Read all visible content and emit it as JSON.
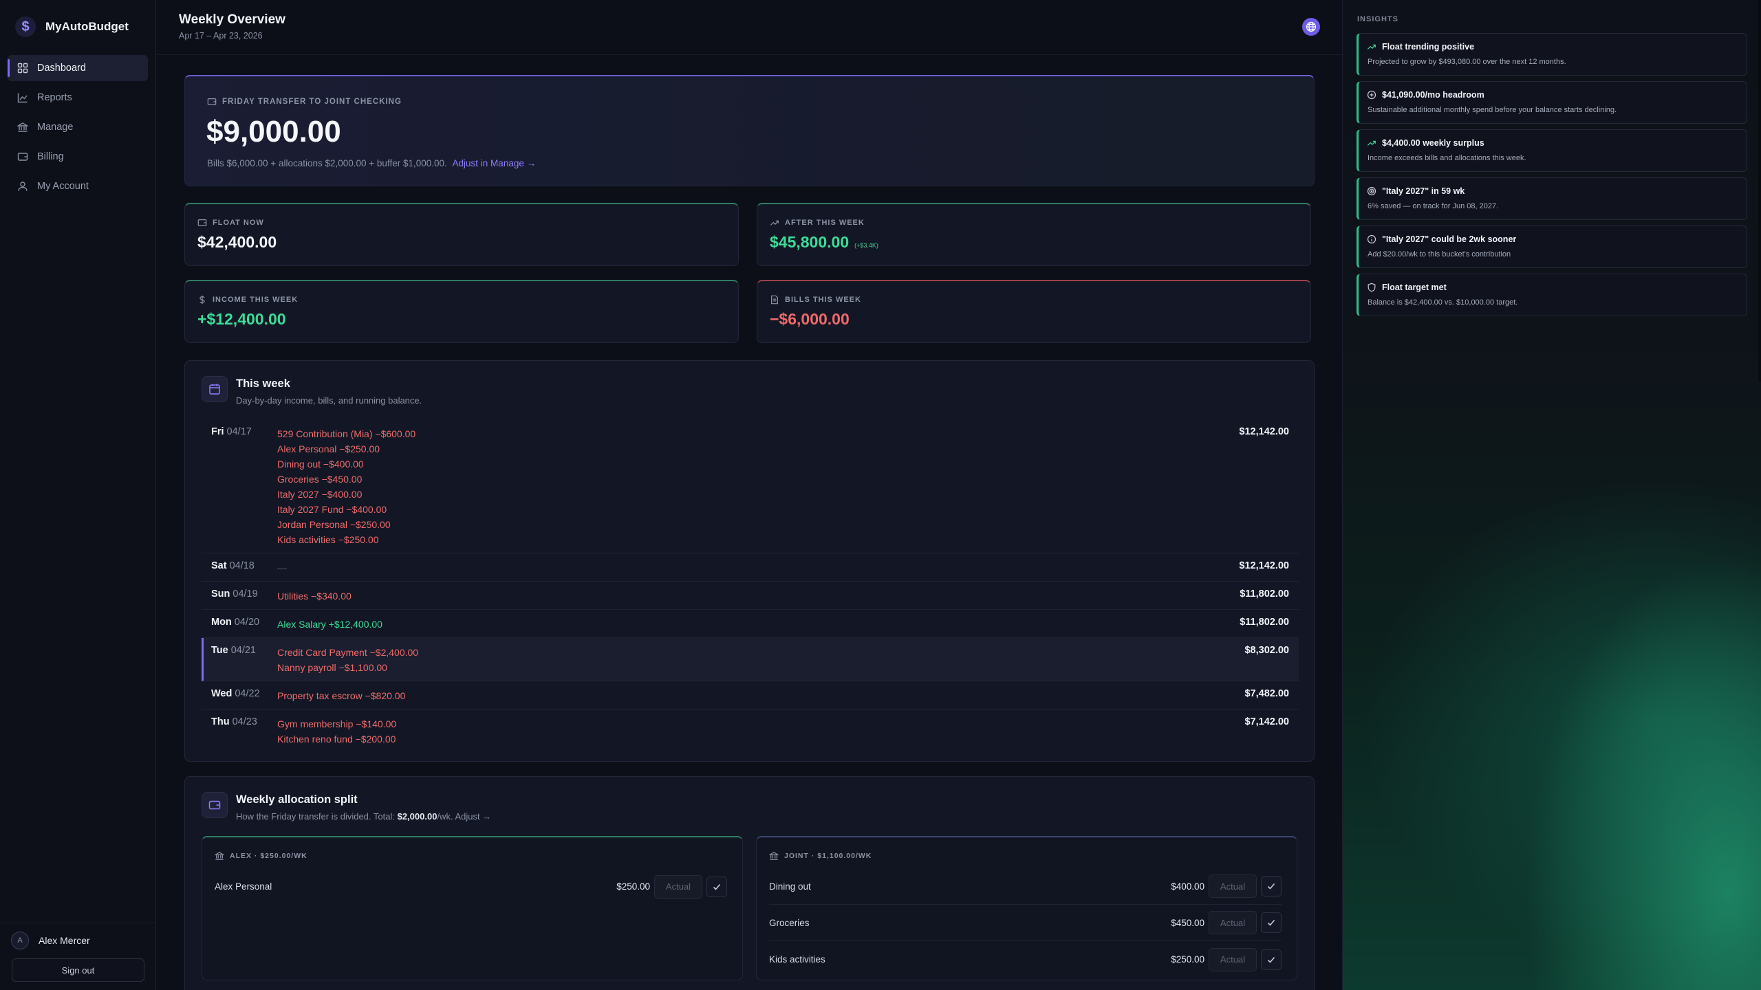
{
  "app": {
    "name": "MyAutoBudget",
    "logo_glyph": "$"
  },
  "sidebar": {
    "items": [
      {
        "label": "Dashboard",
        "icon": "grid-icon",
        "active": true
      },
      {
        "label": "Reports",
        "icon": "chart-line-icon"
      },
      {
        "label": "Manage",
        "icon": "bank-icon"
      },
      {
        "label": "Billing",
        "icon": "wallet-icon"
      },
      {
        "label": "My Account",
        "icon": "user-icon"
      }
    ],
    "user": {
      "initial": "A",
      "name": "Alex Mercer"
    },
    "signout_label": "Sign out"
  },
  "header": {
    "title": "Weekly Overview",
    "date_range": "Apr 17 – Apr 23, 2026"
  },
  "hero": {
    "eyebrow": "FRIDAY TRANSFER TO JOINT CHECKING",
    "amount": "$9,000.00",
    "note": "Bills $6,000.00 + allocations $2,000.00 + buffer $1,000.00.",
    "adjust_link": "Adjust in Manage →"
  },
  "stats": {
    "float_now": {
      "label": "FLOAT NOW",
      "value": "$42,400.00"
    },
    "after_week": {
      "label": "AFTER THIS WEEK",
      "value": "$45,800.00",
      "delta": "(+$3.4K)"
    },
    "income": {
      "label": "INCOME THIS WEEK",
      "value": "+$12,400.00"
    },
    "bills": {
      "label": "BILLS THIS WEEK",
      "value": "−$6,000.00"
    }
  },
  "this_week": {
    "title": "This week",
    "subtitle": "Day-by-day income, bills, and running balance.",
    "days": [
      {
        "dow": "Fri",
        "date": "04/17",
        "balance": "$12,142.00",
        "items": [
          {
            "text": "529 Contribution (Mia) −$600.00",
            "type": "bill"
          },
          {
            "text": "Alex Personal −$250.00",
            "type": "bill"
          },
          {
            "text": "Dining out −$400.00",
            "type": "bill"
          },
          {
            "text": "Groceries −$450.00",
            "type": "bill"
          },
          {
            "text": "Italy 2027 −$400.00",
            "type": "bill"
          },
          {
            "text": "Italy 2027 Fund −$400.00",
            "type": "bill"
          },
          {
            "text": "Jordan Personal −$250.00",
            "type": "bill"
          },
          {
            "text": "Kids activities −$250.00",
            "type": "bill"
          }
        ]
      },
      {
        "dow": "Sat",
        "date": "04/18",
        "balance": "$12,142.00",
        "items": [
          {
            "text": "—",
            "type": "none"
          }
        ]
      },
      {
        "dow": "Sun",
        "date": "04/19",
        "balance": "$11,802.00",
        "items": [
          {
            "text": "Utilities −$340.00",
            "type": "bill"
          }
        ]
      },
      {
        "dow": "Mon",
        "date": "04/20",
        "balance": "$11,802.00",
        "items": [
          {
            "text": "Alex Salary +$12,400.00",
            "type": "income"
          }
        ]
      },
      {
        "dow": "Tue",
        "date": "04/21",
        "balance": "$8,302.00",
        "today": true,
        "items": [
          {
            "text": "Credit Card Payment −$2,400.00",
            "type": "bill"
          },
          {
            "text": "Nanny payroll −$1,100.00",
            "type": "bill"
          }
        ]
      },
      {
        "dow": "Wed",
        "date": "04/22",
        "balance": "$7,482.00",
        "items": [
          {
            "text": "Property tax escrow −$820.00",
            "type": "bill"
          }
        ]
      },
      {
        "dow": "Thu",
        "date": "04/23",
        "balance": "$7,142.00",
        "items": [
          {
            "text": "Gym membership −$140.00",
            "type": "bill"
          },
          {
            "text": "Kitchen reno fund −$200.00",
            "type": "bill"
          }
        ]
      }
    ]
  },
  "allocation": {
    "title": "Weekly allocation split",
    "subtitle_prefix": "How the Friday transfer is divided. Total: ",
    "subtitle_total": "$2,000.00",
    "subtitle_suffix": "/wk. Adjust →",
    "buckets": [
      {
        "label": "ALEX · $250.00/WK",
        "items": [
          {
            "name": "Alex Personal",
            "amount": "$250.00",
            "actual_placeholder": "Actual"
          }
        ]
      },
      {
        "label": "JOINT · $1,100.00/WK",
        "items": [
          {
            "name": "Dining out",
            "amount": "$400.00",
            "actual_placeholder": "Actual"
          },
          {
            "name": "Groceries",
            "amount": "$450.00",
            "actual_placeholder": "Actual"
          },
          {
            "name": "Kids activities",
            "amount": "$250.00",
            "actual_placeholder": "Actual"
          }
        ]
      }
    ]
  },
  "insights": {
    "title": "INSIGHTS",
    "items": [
      {
        "icon": "trend-up-icon",
        "title": "Float trending positive",
        "body": "Projected to grow by $493,080.00 over the next 12 months."
      },
      {
        "icon": "plus-circle-icon",
        "title": "$41,090.00/mo headroom",
        "body": "Sustainable additional monthly spend before your balance starts declining."
      },
      {
        "icon": "trend-up-icon",
        "title": "$4,400.00 weekly surplus",
        "body": "Income exceeds bills and allocations this week."
      },
      {
        "icon": "target-icon",
        "title": "\"Italy 2027\" in 59 wk",
        "body": "6% saved — on track for Jun 08, 2027."
      },
      {
        "icon": "info-icon",
        "title": "\"Italy 2027\" could be 2wk sooner",
        "body": "Add $20.00/wk to this bucket's contribution"
      },
      {
        "icon": "shield-icon",
        "title": "Float target met",
        "body": "Balance is $42,400.00 vs. $10,000.00 target."
      }
    ]
  },
  "colors": {
    "accent": "#7c6cf0",
    "income": "#3ddc97",
    "bill": "#ef6b6b",
    "background": "#0c0f18"
  }
}
